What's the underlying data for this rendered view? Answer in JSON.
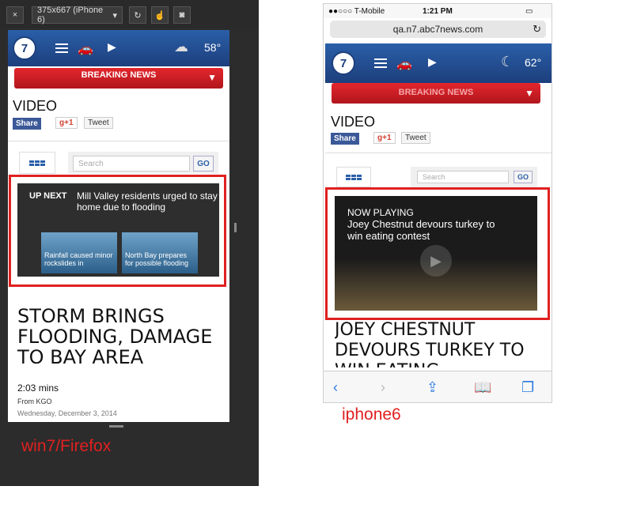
{
  "firefox": {
    "toolbar": {
      "close": "×",
      "device_select": "375x667 (iPhone 6)",
      "rotate_icon": "rotate-icon",
      "touch_icon": "touch-icon",
      "screenshot_icon": "camera-icon"
    },
    "site": {
      "logo": "7",
      "weather": "58°",
      "breaking": "BREAKING NEWS",
      "section_title": "VIDEO",
      "share": {
        "facebook": "Share",
        "google": "g+1",
        "twitter": "Tweet"
      },
      "search_placeholder": "Search",
      "go": "GO",
      "up_next_label": "UP NEXT",
      "up_next_title": "Mill Valley residents urged to stay home due to flooding",
      "thumb1": "Rainfall caused minor rockslides in",
      "thumb2": "North Bay prepares for possible flooding",
      "headline": "STORM BRINGS FLOODING, DAMAGE TO BAY AREA",
      "duration": "2:03 mins",
      "source": "From KGO",
      "date": "Wednesday, December 3, 2014"
    },
    "caption": "win7/Firefox"
  },
  "iphone": {
    "status": {
      "carrier": "●●○○○ T-Mobile",
      "time": "1:21 PM"
    },
    "url": "qa.n7.abc7news.com",
    "site": {
      "logo": "7",
      "weather": "62°",
      "breaking": "BREAKING NEWS",
      "section_title": "VIDEO",
      "share": {
        "facebook": "Share",
        "google": "g+1",
        "twitter": "Tweet"
      },
      "search_placeholder": "Search",
      "go": "GO",
      "now_playing_label": "NOW PLAYING",
      "now_playing_title": "Joey Chestnut devours turkey to win eating contest",
      "headline": "JOEY CHESTNUT DEVOURS TURKEY TO WIN EATING"
    },
    "caption": "iphone6"
  },
  "colors": {
    "accent_red": "#e02020",
    "abc_blue": "#1d3f7d"
  }
}
